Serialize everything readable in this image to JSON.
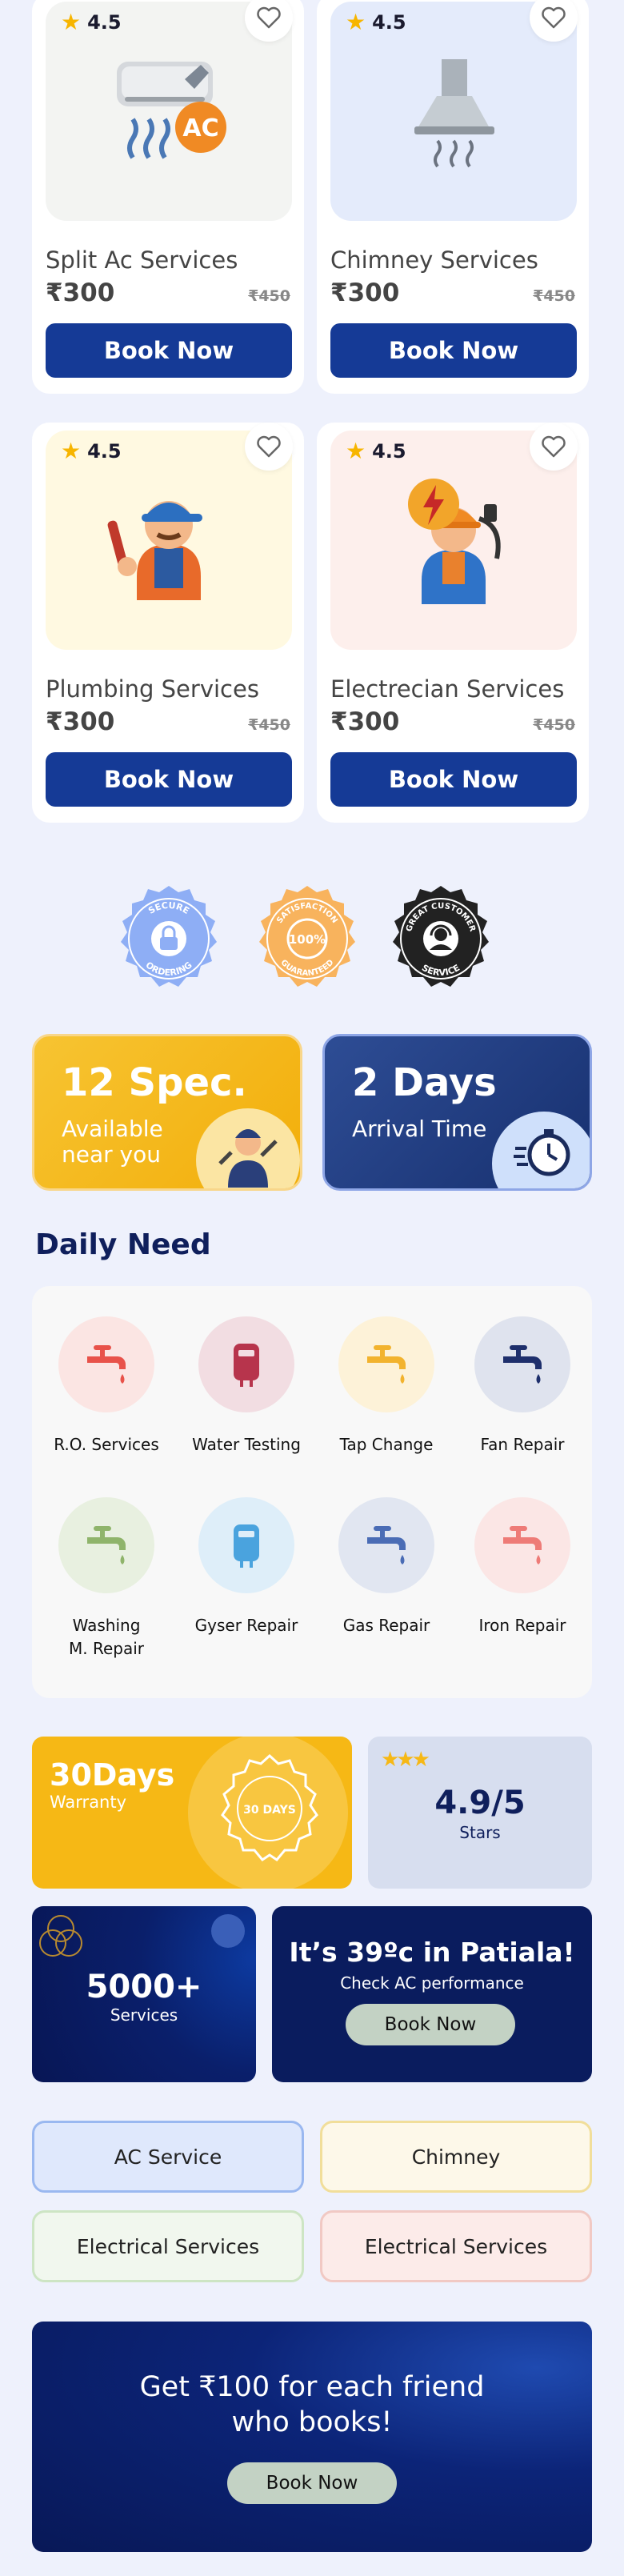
{
  "products": [
    {
      "name": "Split Ac Services",
      "rating": "4.5",
      "price": "₹300",
      "old_price": "₹450",
      "book": "Book Now",
      "icon": "ac-unit-icon",
      "bg": "#f3f4f2"
    },
    {
      "name": "Chimney Services",
      "rating": "4.5",
      "price": "₹300",
      "old_price": "₹450",
      "book": "Book Now",
      "icon": "chimney-hood-icon",
      "bg": "#e4ebfb"
    },
    {
      "name": "Plumbing Services",
      "rating": "4.5",
      "price": "₹300",
      "old_price": "₹450",
      "book": "Book Now",
      "icon": "plumber-icon",
      "bg": "#fff9e1"
    },
    {
      "name": "Electrecian Services",
      "rating": "4.5",
      "price": "₹300",
      "old_price": "₹450",
      "book": "Book Now",
      "icon": "electrician-icon",
      "bg": "#fdefec"
    }
  ],
  "trust_badges": [
    {
      "top": "SECURE",
      "bottom": "ORDERING",
      "color": "#8eaef5",
      "icon": "lock-icon"
    },
    {
      "top": "SATISFACTION",
      "center": "100%",
      "bottom": "GUARANTEED",
      "color": "#f8b35d",
      "icon": "guarantee-icon"
    },
    {
      "top": "GREAT CUSTOMER",
      "bottom": "SERVICE",
      "color": "#222",
      "icon": "support-agent-icon"
    }
  ],
  "stats": {
    "specialists": {
      "value": "12 Spec.",
      "label": "Available near you",
      "color": "#f5b613"
    },
    "arrival": {
      "value": "2 Days",
      "label": "Arrival Time",
      "color": "#1f3b8a"
    }
  },
  "daily_need": {
    "title": "Daily Need",
    "items": [
      {
        "label": "R.O. Services",
        "color": "#e8524a",
        "bg": "#fbe5e3"
      },
      {
        "label": "Water Testing",
        "color": "#b7344c",
        "bg": "#f2dde2"
      },
      {
        "label": "Tap Change",
        "color": "#f2b32e",
        "bg": "#fdf2d8"
      },
      {
        "label": "Fan Repair",
        "color": "#1e2f6c",
        "bg": "#dfe3ee"
      },
      {
        "label": "Washing M. Repair",
        "color": "#8fb46b",
        "bg": "#e8f0e0"
      },
      {
        "label": "Gyser Repair",
        "color": "#4aa3de",
        "bg": "#deeef9"
      },
      {
        "label": "Gas Repair",
        "color": "#4a6cb5",
        "bg": "#e1e6f1"
      },
      {
        "label": "Iron Repair",
        "color": "#ee7b77",
        "bg": "#fbe6e5"
      }
    ]
  },
  "warranty": {
    "value": "30Days",
    "label": "Warranty",
    "seal": "30 DAYS"
  },
  "stars": {
    "value": "4.9/5",
    "label": "Stars"
  },
  "served": {
    "value": "5000+",
    "label": "Services"
  },
  "weather": {
    "headline": "It’s 39ºc in Patiala!",
    "sub": "Check AC performance",
    "button": "Book Now"
  },
  "chips": [
    {
      "label": "AC Service",
      "bg": "#dfe8fc",
      "border": "#9ab8f0"
    },
    {
      "label": "Chimney",
      "bg": "#fdf8e9",
      "border": "#f1de9a"
    },
    {
      "label": "Electrical Services",
      "bg": "#f1f7ee",
      "border": "#cde5c4"
    },
    {
      "label": "Electrical Services",
      "bg": "#fcebe9",
      "border": "#f1c9c4"
    }
  ],
  "referral": {
    "headline": "Get ₹100 for each friend who books!",
    "button": "Book Now"
  }
}
